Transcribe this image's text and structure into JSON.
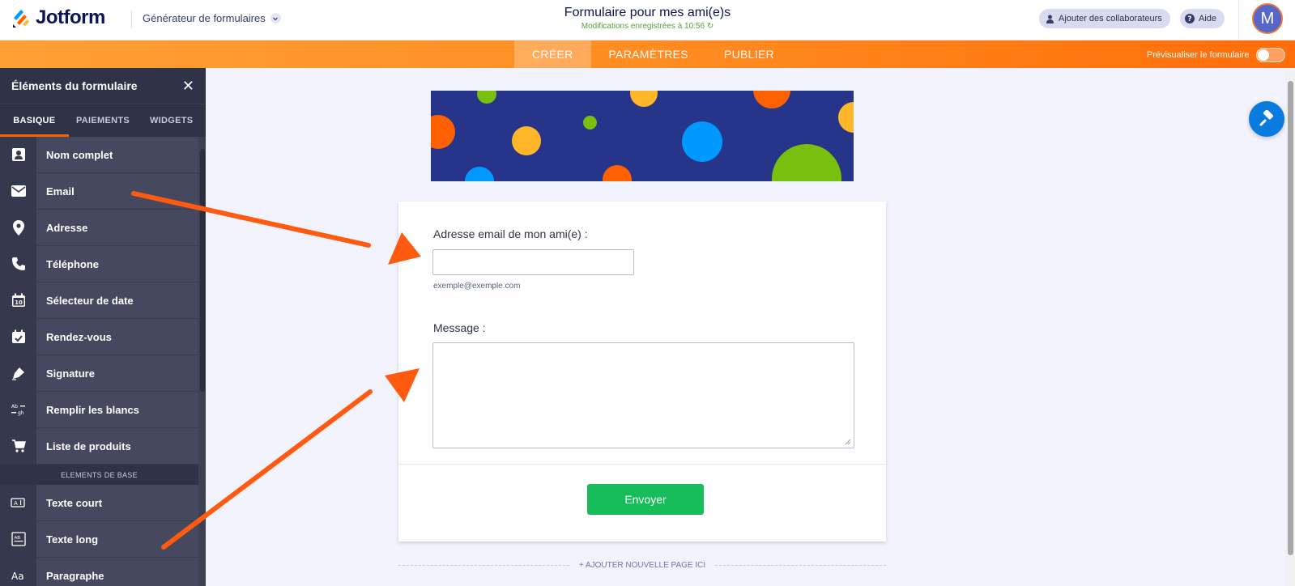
{
  "header": {
    "logo_text": "Jotform",
    "builder_label": "Générateur de formulaires",
    "form_title": "Formulaire pour mes ami(e)s",
    "saved_status": "Modifications enregistrées à 10:56",
    "collab_label": "Ajouter des collaborateurs",
    "help_label": "Aide",
    "avatar_initial": "M"
  },
  "nav": {
    "tabs": [
      {
        "label": "CRÉER",
        "active": true
      },
      {
        "label": "PARAMÈTRES",
        "active": false
      },
      {
        "label": "PUBLIER",
        "active": false
      }
    ],
    "preview_label": "Prévisualiser le formulaire"
  },
  "sidebar": {
    "title": "Éléments du formulaire",
    "tabs": [
      {
        "label": "BASIQUE",
        "active": true
      },
      {
        "label": "PAIEMENTS",
        "active": false
      },
      {
        "label": "WIDGETS",
        "active": false
      }
    ],
    "items": [
      {
        "label": "Nom complet",
        "icon": "id-card-icon"
      },
      {
        "label": "Email",
        "icon": "envelope-icon"
      },
      {
        "label": "Adresse",
        "icon": "map-pin-icon"
      },
      {
        "label": "Téléphone",
        "icon": "phone-icon"
      },
      {
        "label": "Sélecteur de date",
        "icon": "calendar-10-icon"
      },
      {
        "label": "Rendez-vous",
        "icon": "calendar-check-icon"
      },
      {
        "label": "Signature",
        "icon": "pen-nib-icon"
      },
      {
        "label": "Remplir les blancs",
        "icon": "fill-blanks-icon"
      },
      {
        "label": "Liste de produits",
        "icon": "cart-icon"
      }
    ],
    "section_label": "ELEMENTS DE BASE",
    "items2": [
      {
        "label": "Texte court",
        "icon": "short-text-icon"
      },
      {
        "label": "Texte long",
        "icon": "long-text-icon"
      },
      {
        "label": "Paragraphe",
        "icon": "paragraph-icon"
      }
    ]
  },
  "form": {
    "email_label": "Adresse email de mon ami(e) :",
    "email_value": "",
    "email_sublabel": "exemple@exemple.com",
    "message_label": "Message :",
    "message_value": "",
    "submit_label": "Envoyer",
    "add_page_label": "+ AJOUTER NOUVELLE PAGE ICI"
  },
  "colors": {
    "accent_orange": "#ff6100",
    "sidebar_bg": "#45485e",
    "submit_green": "#18bd5b",
    "fab_blue": "#0a7bde"
  }
}
